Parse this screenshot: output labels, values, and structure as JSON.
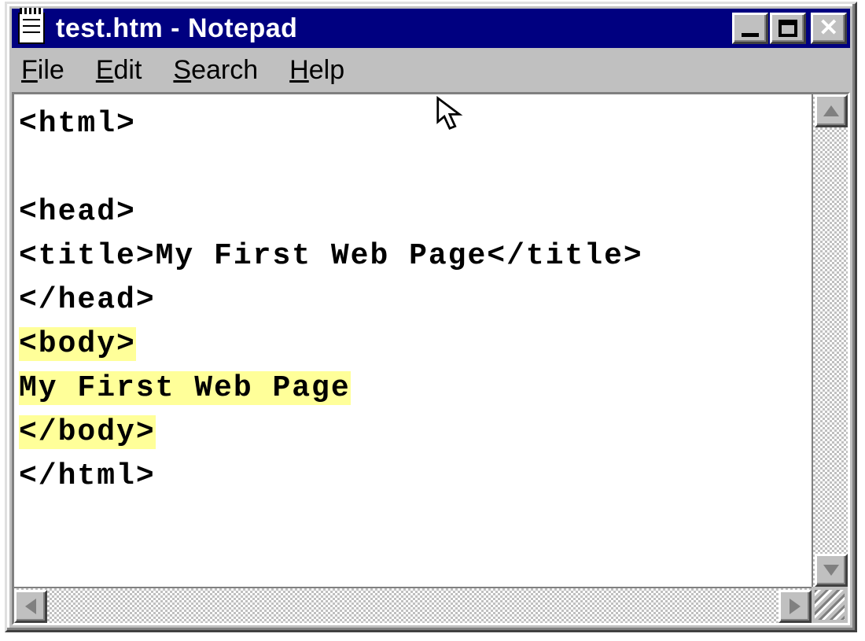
{
  "window": {
    "title": "test.htm - Notepad",
    "icon": "notepad-icon"
  },
  "menu": {
    "items": [
      {
        "label": "File",
        "accel_index": 0
      },
      {
        "label": "Edit",
        "accel_index": 0
      },
      {
        "label": "Search",
        "accel_index": 0
      },
      {
        "label": "Help",
        "accel_index": 0
      }
    ]
  },
  "editor": {
    "highlight_color": "#ffff99",
    "lines": [
      {
        "text": "<html>",
        "highlighted": false
      },
      {
        "text": "",
        "highlighted": false
      },
      {
        "text": "<head>",
        "highlighted": false
      },
      {
        "text": "<title>My First Web Page</title>",
        "highlighted": false
      },
      {
        "text": "</head>",
        "highlighted": false
      },
      {
        "text": "<body>",
        "highlighted": true
      },
      {
        "text": "My First Web Page",
        "highlighted": true
      },
      {
        "text": "</body>",
        "highlighted": true
      },
      {
        "text": "</html>",
        "highlighted": false
      }
    ]
  },
  "window_controls": {
    "minimize": "Minimize",
    "maximize": "Maximize",
    "close": "Close"
  }
}
